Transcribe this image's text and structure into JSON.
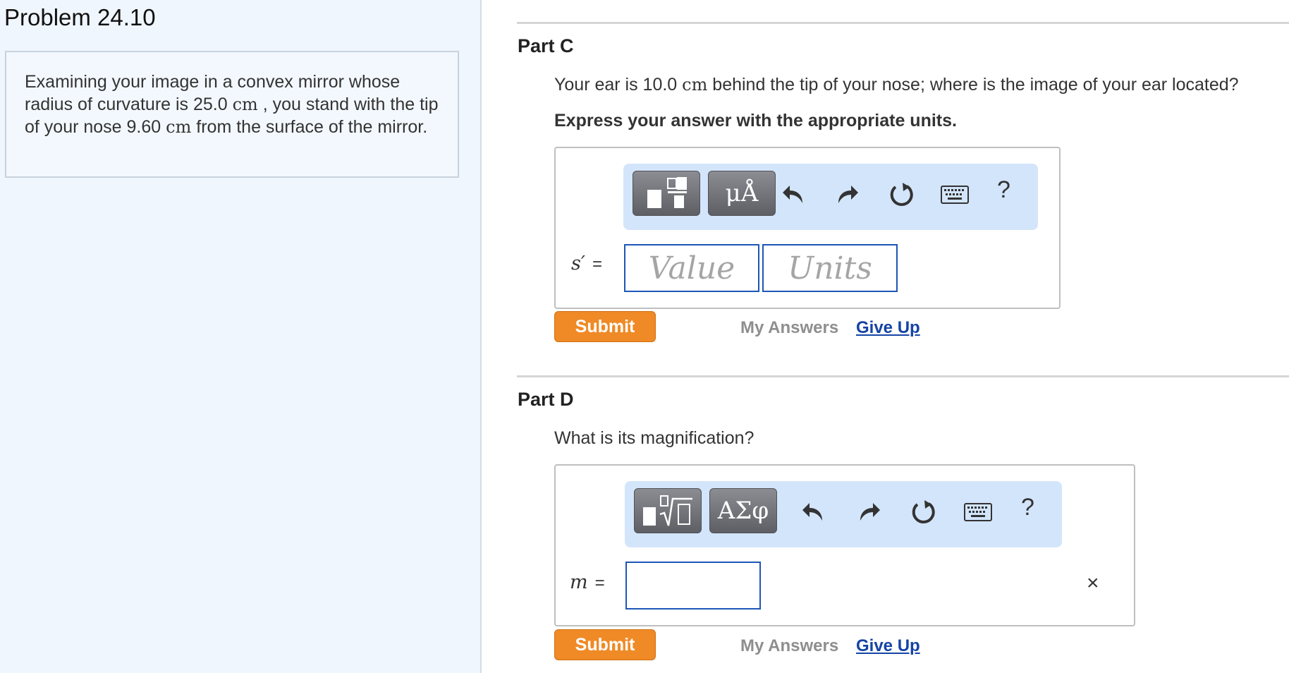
{
  "problem": {
    "title": "Problem 24.10",
    "text_1": "Examining your image in a convex mirror whose radius of curvature is 25.0 ",
    "unit_1": "cm",
    "text_2": " , you stand with the tip of your nose 9.60 ",
    "unit_2": "cm",
    "text_3": " from the surface of the mirror."
  },
  "part_c": {
    "title": "Part C",
    "question_1": "Your ear is 10.0 ",
    "question_unit": "cm",
    "question_2": " behind the tip of your nose; where is the image of your ear located?",
    "instruction": "Express your answer with the appropriate units.",
    "toolbar": {
      "button_1_icon": "fraction-template-icon",
      "button_2_label": "μÅ",
      "undo_icon": "undo-icon",
      "redo_icon": "redo-icon",
      "reset_icon": "reset-icon",
      "keyboard_icon": "keyboard-icon",
      "help_label": "?"
    },
    "variable": "s′",
    "equals": "=",
    "value_placeholder": "Value",
    "units_placeholder": "Units",
    "submit_label": "Submit",
    "my_answers_label": "My Answers",
    "give_up_label": "Give Up"
  },
  "part_d": {
    "title": "Part D",
    "question": "What is its magnification?",
    "toolbar": {
      "button_1_icon": "sqrt-template-icon",
      "button_2_label": "ΑΣφ",
      "undo_icon": "undo-icon",
      "redo_icon": "redo-icon",
      "reset_icon": "reset-icon",
      "keyboard_icon": "keyboard-icon",
      "help_label": "?"
    },
    "variable": "m",
    "equals": "=",
    "value": "",
    "close_label": "×",
    "submit_label": "Submit",
    "my_answers_label": "My Answers",
    "give_up_label": "Give Up"
  },
  "colors": {
    "accent_submit": "#ef8a26",
    "link": "#1544a3",
    "input_border": "#1d56b8",
    "toolbar_bg": "#d3e5fb",
    "left_pane_bg": "#f0f6fd"
  }
}
